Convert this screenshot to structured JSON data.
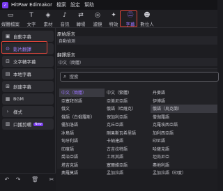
{
  "titlebar": {
    "app_name": "HitPaw Edimakor",
    "menu": [
      "檔案",
      "設定",
      "幫助"
    ]
  },
  "toolbar": {
    "tools": [
      {
        "label": "媒體檔案",
        "icon": "folder-icon",
        "glyph": "▭"
      },
      {
        "label": "文字",
        "icon": "text-icon",
        "glyph": "T"
      },
      {
        "label": "素材",
        "icon": "cube-icon",
        "glyph": "◈"
      },
      {
        "label": "音訊",
        "icon": "music-icon",
        "glyph": "♪"
      },
      {
        "label": "轉場",
        "icon": "transition-icon",
        "glyph": "⇄"
      },
      {
        "label": "濾鏡",
        "icon": "filter-icon",
        "glyph": "◎"
      },
      {
        "label": "特效",
        "icon": "sparkle-icon",
        "glyph": "✦"
      },
      {
        "label": "字幕",
        "icon": "subtitle-icon",
        "glyph": "㊁"
      },
      {
        "label": "數位人",
        "icon": "avatar-icon",
        "glyph": "☻"
      }
    ],
    "active_index": 7
  },
  "sidebar": {
    "items": [
      {
        "label": "自動字幕",
        "icon": "auto-subtitle-icon",
        "glyph": "▣"
      },
      {
        "label": "影片翻譯",
        "icon": "video-translate-icon",
        "glyph": "⊙"
      },
      {
        "label": "文字轉字幕",
        "icon": "text-to-subtitle-icon",
        "glyph": "⊟"
      },
      {
        "label": "本地字幕",
        "icon": "local-subtitle-icon",
        "glyph": "▤"
      },
      {
        "label": "創建字幕",
        "icon": "create-subtitle-icon",
        "glyph": "⊞"
      },
      {
        "label": "BGM",
        "icon": "bgm-icon",
        "glyph": "▦"
      },
      {
        "label": "樣式",
        "icon": "expand-chevron-icon",
        "glyph": "›"
      },
      {
        "label": "口播剪輯",
        "icon": "speech-edit-icon",
        "glyph": "▥",
        "badge": "New"
      }
    ],
    "selected_index": 1
  },
  "bottombar": {
    "icons": [
      {
        "name": "undo-icon",
        "glyph": "↶"
      },
      {
        "name": "redo-icon",
        "glyph": "↷"
      },
      {
        "name": "delete-icon",
        "glyph": "🗑"
      },
      {
        "name": "cut-icon",
        "glyph": "✂"
      }
    ]
  },
  "panel": {
    "original_label": "原始語言",
    "original_value": "自動偵測",
    "translate_label": "翻譯語言",
    "translate_value": "中文（簡體）",
    "search_placeholder": "搜索"
  },
  "languages": [
    [
      "中文（簡體）",
      "中文（繁體）",
      "丹麥語"
    ],
    [
      "亞塞拜然語",
      "亞美尼亞語",
      "伊博語"
    ],
    [
      "俄文",
      "俄語（哈薩克）",
      "俄語（烏克蘭）"
    ],
    [
      "俄語（白俄羅斯）",
      "保加利亞語",
      "僧伽羅語"
    ],
    [
      "優加洛語",
      "克丘亞語",
      "克羅埃西亞語"
    ],
    [
      "冰島語",
      "剛果斯瓦希里語",
      "加利西亞語"
    ],
    [
      "匈牙利語",
      "卡納達語",
      "印尼語"
    ],
    [
      "印度語",
      "古吉拉特語",
      "哈薩克語"
    ],
    [
      "喬治亞語",
      "土耳其語",
      "坦尚尼亞"
    ],
    [
      "塔吉克語",
      "塞爾維亞語",
      "奧地利語"
    ],
    [
      "奧羅莫語",
      "孟加拉語",
      "孟加拉語（印度）"
    ]
  ],
  "selected_language": [
    0,
    0
  ],
  "hovered_language": [
    2,
    2
  ],
  "colors": {
    "accent": "#9b74ff",
    "highlight": "#e0453a"
  }
}
